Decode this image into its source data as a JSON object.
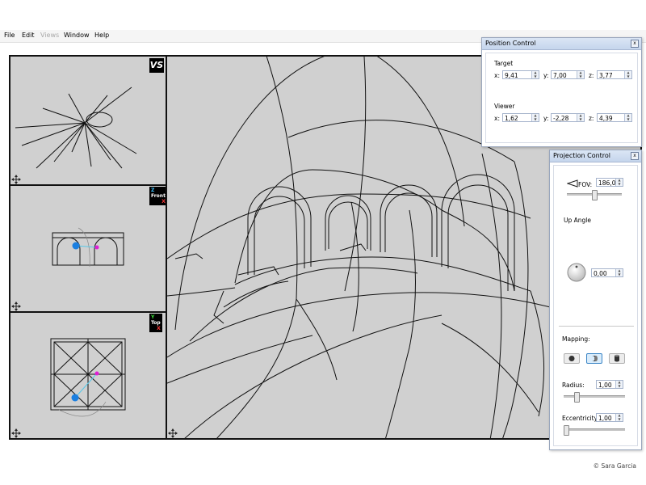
{
  "menu": {
    "items": [
      {
        "label": "File",
        "enabled": true
      },
      {
        "label": "Edit",
        "enabled": true
      },
      {
        "label": "Views",
        "enabled": false
      },
      {
        "label": "Window",
        "enabled": true
      },
      {
        "label": "Help",
        "enabled": true
      }
    ]
  },
  "viewports": {
    "logo": "VS",
    "front_tag": {
      "axis_top": "Z",
      "name": "Front",
      "axis_bottom": "X"
    },
    "top_tag": {
      "axis_top": "Y",
      "name": "Top",
      "axis_bottom": "X"
    }
  },
  "position_control": {
    "title": "Position Control",
    "close_glyph": "x",
    "target_label": "Target",
    "viewer_label": "Viewer",
    "target": {
      "x_label": "x:",
      "x": "9,41",
      "y_label": "y:",
      "y": "7,00",
      "z_label": "z:",
      "z": "3,77"
    },
    "viewer": {
      "x_label": "x:",
      "x": "1,62",
      "y_label": "y:",
      "y": "-2,28",
      "z_label": "z:",
      "z": "4,39"
    }
  },
  "projection_control": {
    "title": "Projection Control",
    "close_glyph": "x",
    "fov_label": "FOV:",
    "fov_value": "186,00",
    "fov_slider": 0.5,
    "up_angle_label": "Up Angle",
    "up_angle_value": "0,00",
    "mapping_label": "Mapping:",
    "mapping_selected": 1,
    "radius_label": "Radius:",
    "radius_value": "1,00",
    "radius_slider": 0.18,
    "eccentricity_label": "Eccentricity:",
    "eccentricity_value": "1,00",
    "eccentricity_slider": 0.0
  },
  "footer": {
    "copyright": "© Sara Garcia"
  },
  "colors": {
    "viewport_bg": "#d0d0d0",
    "viewer_point": "#1b7fe0",
    "target_point": "#e01fd6",
    "sight_line": "#55c8e8"
  }
}
